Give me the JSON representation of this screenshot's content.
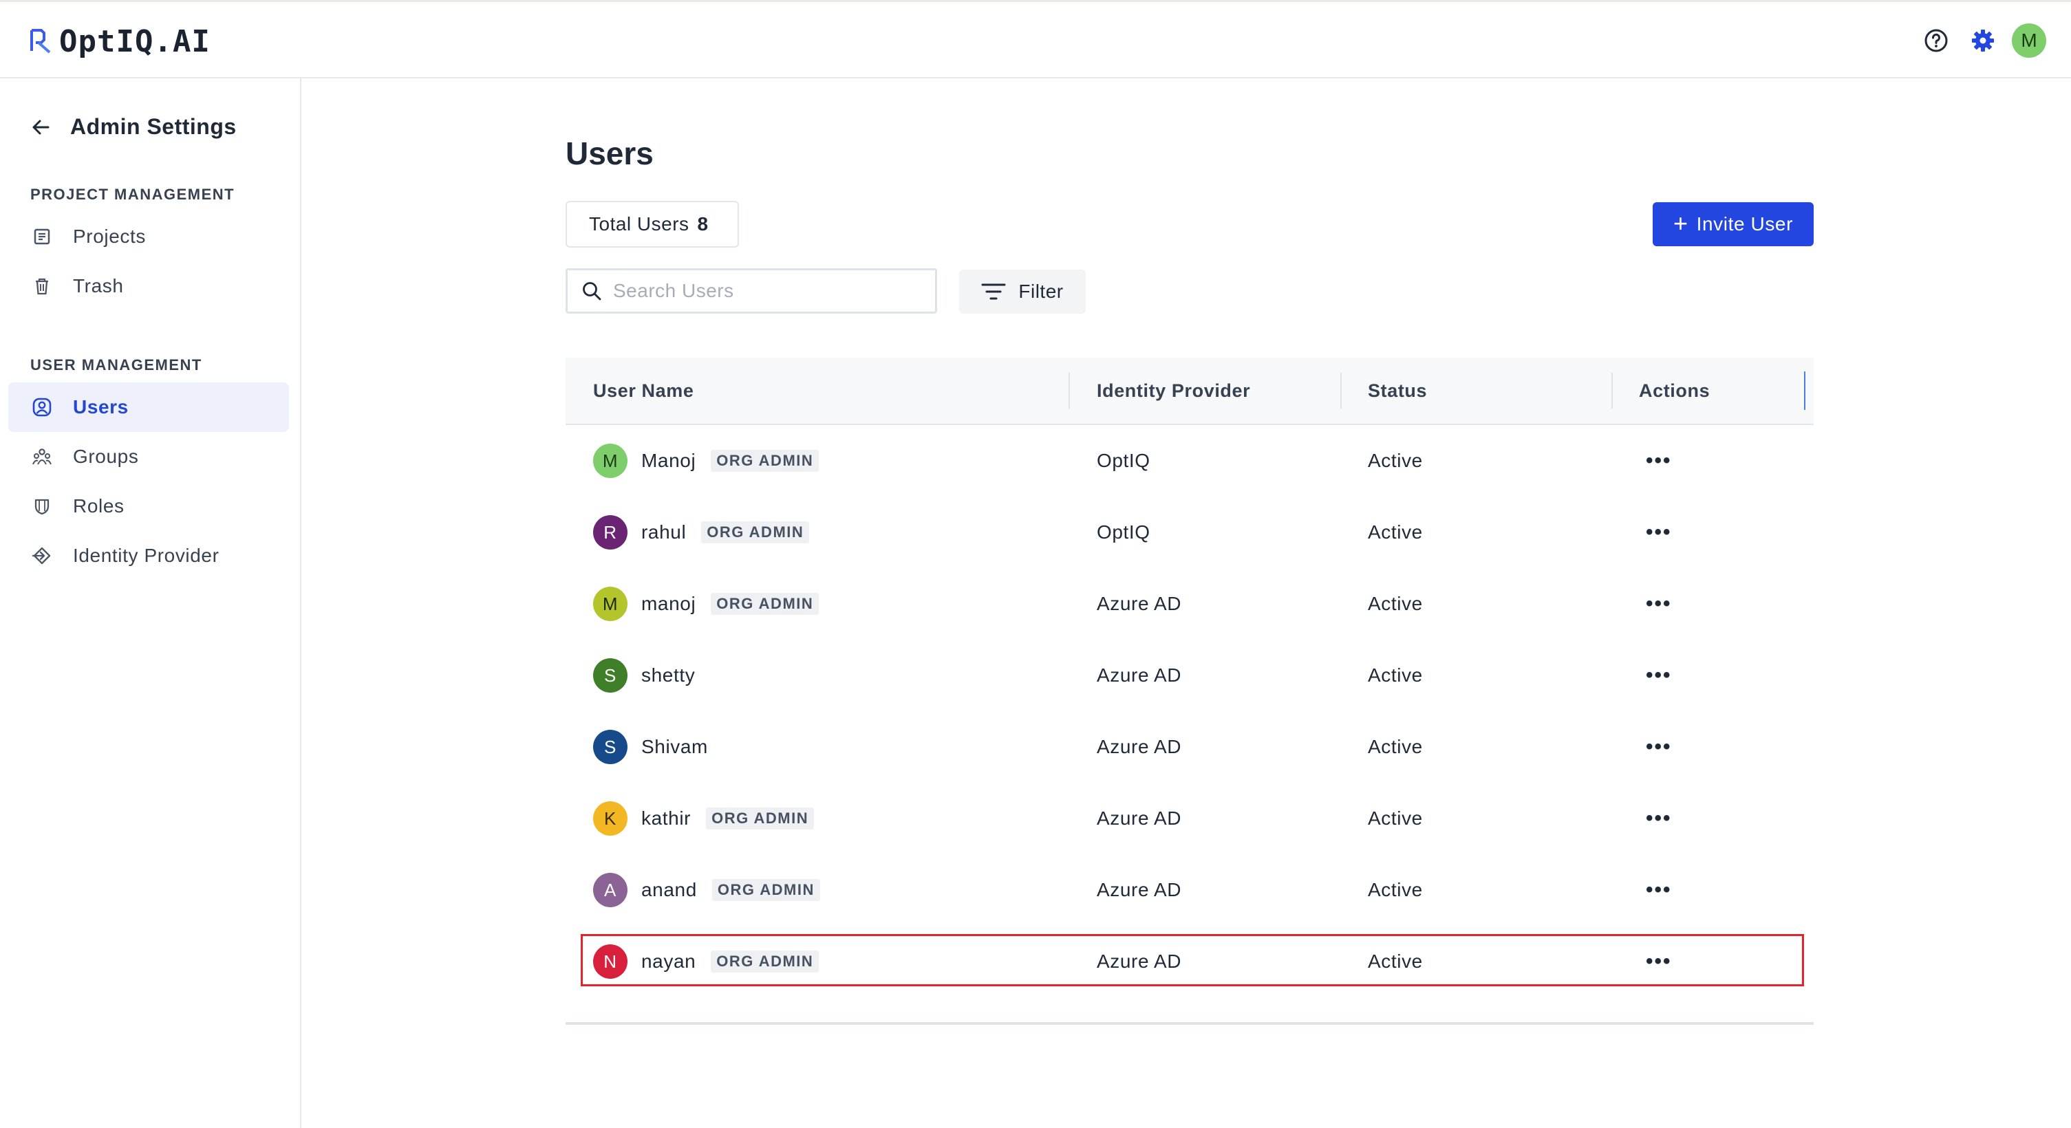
{
  "app": {
    "logo_text": "OptIQ.AI",
    "user_initial": "M"
  },
  "sidebar": {
    "title": "Admin Settings",
    "sections": [
      {
        "label": "PROJECT MANAGEMENT",
        "items": [
          {
            "label": "Projects",
            "icon": "document-icon"
          },
          {
            "label": "Trash",
            "icon": "trash-icon"
          }
        ]
      },
      {
        "label": "USER MANAGEMENT",
        "items": [
          {
            "label": "Users",
            "icon": "user-circle-icon",
            "active": true
          },
          {
            "label": "Groups",
            "icon": "group-icon"
          },
          {
            "label": "Roles",
            "icon": "shield-icon"
          },
          {
            "label": "Identity Provider",
            "icon": "login-icon"
          }
        ]
      }
    ]
  },
  "main": {
    "title": "Users",
    "total_label": "Total Users",
    "total_count": "8",
    "invite_label": "Invite User",
    "search_placeholder": "Search Users",
    "filter_label": "Filter",
    "columns": [
      "User Name",
      "Identity Provider",
      "Status",
      "Actions"
    ],
    "users": [
      {
        "initial": "M",
        "name": "Manoj",
        "badge": "ORG ADMIN",
        "provider": "OptIQ",
        "status": "Active",
        "color": "#7fce6c",
        "text_color": "#1a3a12"
      },
      {
        "initial": "R",
        "name": "rahul",
        "badge": "ORG ADMIN",
        "provider": "OptIQ",
        "status": "Active",
        "color": "#6b2473",
        "text_color": "#ffffff"
      },
      {
        "initial": "M",
        "name": "manoj",
        "badge": "ORG ADMIN",
        "provider": "Azure AD",
        "status": "Active",
        "color": "#b4c52b",
        "text_color": "#1a2a08"
      },
      {
        "initial": "S",
        "name": "shetty",
        "badge": "",
        "provider": "Azure AD",
        "status": "Active",
        "color": "#3f7f2a",
        "text_color": "#ffffff"
      },
      {
        "initial": "S",
        "name": "Shivam",
        "badge": "",
        "provider": "Azure AD",
        "status": "Active",
        "color": "#164a8a",
        "text_color": "#ffffff"
      },
      {
        "initial": "K",
        "name": "kathir",
        "badge": "ORG ADMIN",
        "provider": "Azure AD",
        "status": "Active",
        "color": "#f2b723",
        "text_color": "#3a2a05"
      },
      {
        "initial": "A",
        "name": "anand",
        "badge": "ORG ADMIN",
        "provider": "Azure AD",
        "status": "Active",
        "color": "#8b6394",
        "text_color": "#ffffff"
      },
      {
        "initial": "N",
        "name": "nayan",
        "badge": "ORG ADMIN",
        "provider": "Azure AD",
        "status": "Active",
        "color": "#d81f3c",
        "text_color": "#ffffff"
      }
    ],
    "actions_glyph": "•••"
  },
  "colors": {
    "accent": "#2346e0",
    "highlight": "#e0262b"
  }
}
